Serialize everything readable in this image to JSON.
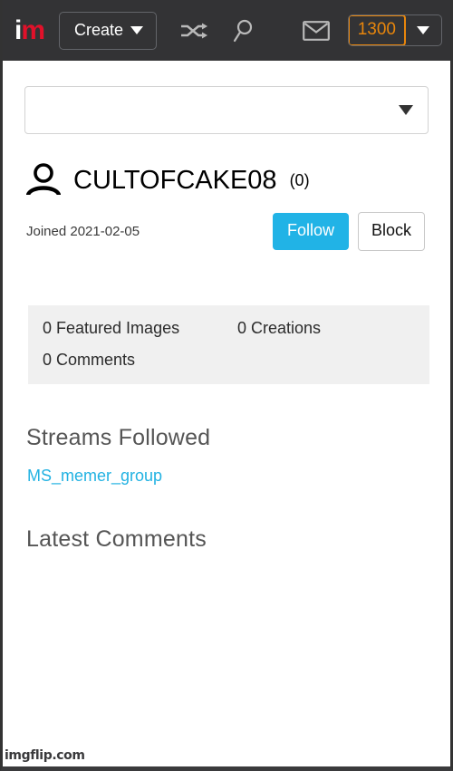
{
  "header": {
    "logo_i": "i",
    "logo_m": "m",
    "create_label": "Create",
    "shuffle_icon": "shuffle-icon",
    "search_icon": "search-icon",
    "mail_icon": "mail-icon",
    "points": "1300",
    "points_color": "#e8860c",
    "background": "#333335"
  },
  "page": {
    "select_value": "",
    "select_placeholder": "",
    "user": {
      "avatar_icon": "person-icon",
      "name": "CULTOFCAKE08",
      "count": "(0)",
      "joined": "Joined 2021-02-05"
    },
    "actions": {
      "follow_label": "Follow",
      "follow_color": "#21b3e6",
      "block_label": "Block"
    },
    "stats": [
      "0 Featured Images",
      "0 Creations",
      "0 Comments"
    ],
    "streams": {
      "title": "Streams Followed",
      "items": [
        {
          "label": "MS_memer_group",
          "color": "#22b2e2"
        }
      ]
    },
    "comments": {
      "title": "Latest Comments",
      "items": []
    }
  },
  "watermark": "imgflip.com"
}
